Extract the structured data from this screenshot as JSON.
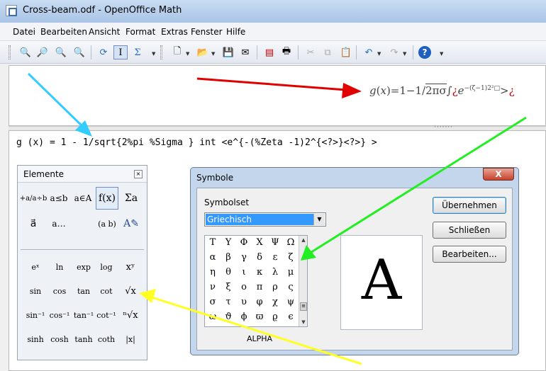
{
  "window": {
    "title": "Cross-beam.odf - OpenOffice Math"
  },
  "menubar": [
    "Datei",
    "Bearbeiten",
    "Ansicht",
    "Format",
    "Extras",
    "Fenster",
    "Hilfe"
  ],
  "formula_preview": {
    "lhs": "g",
    "x": "x",
    "rhs": "=1−1/",
    "radicand": "2πσ",
    "integral": "∫",
    "q1": "¿",
    "e": "e",
    "exponent": "−(ζ−1)2²□",
    "gt": ">",
    "q2": "¿"
  },
  "command": "g (x) = 1 - 1/sqrt{2%pi %Sigma } int <e^{-(%Zeta -1)2^{<?>}<?>} >",
  "elements_panel": {
    "title": "Elemente",
    "close": "⨯",
    "categories_row1": [
      "+a/a÷b",
      "a≤b",
      "a∈A",
      "f(x)",
      "Σa"
    ],
    "categories_row2": [
      "a⃗",
      "a…",
      "(a b)",
      "A✎"
    ],
    "functions": [
      [
        "eˣ",
        "ln",
        "exp",
        "log",
        "xʸ"
      ],
      [
        "sin",
        "cos",
        "tan",
        "cot",
        "√x"
      ],
      [
        "sin⁻¹",
        "cos⁻¹",
        "tan⁻¹",
        "cot⁻¹",
        "ⁿ√x"
      ],
      [
        "sinh",
        "cosh",
        "tanh",
        "coth",
        "|x|"
      ]
    ]
  },
  "symbols_dialog": {
    "title": "Symbole",
    "close": "X",
    "symbolset_label": "Symbolset",
    "symbolset_value": "Griechisch",
    "grid": [
      [
        "Τ",
        "Υ",
        "Φ",
        "Χ",
        "Ψ",
        "Ω"
      ],
      [
        "α",
        "β",
        "γ",
        "δ",
        "ε",
        "ζ"
      ],
      [
        "η",
        "θ",
        "ι",
        "κ",
        "λ",
        "μ"
      ],
      [
        "ν",
        "ξ",
        "ο",
        "π",
        "ρ",
        "ς"
      ],
      [
        "σ",
        "τ",
        "υ",
        "φ",
        "χ",
        "ψ"
      ],
      [
        "ω",
        "ϑ",
        "ϕ",
        "ϖ",
        "ϱ",
        "ϵ"
      ]
    ],
    "preview_glyph": "A",
    "symbol_name": "ALPHA",
    "buttons": {
      "apply": "Übernehmen",
      "close": "Schließen",
      "edit": "Bearbeiten..."
    }
  },
  "annotation_colors": {
    "cyan": "#33ccff",
    "red": "#e00000",
    "green": "#22ee22",
    "yellow": "#ffff22"
  }
}
